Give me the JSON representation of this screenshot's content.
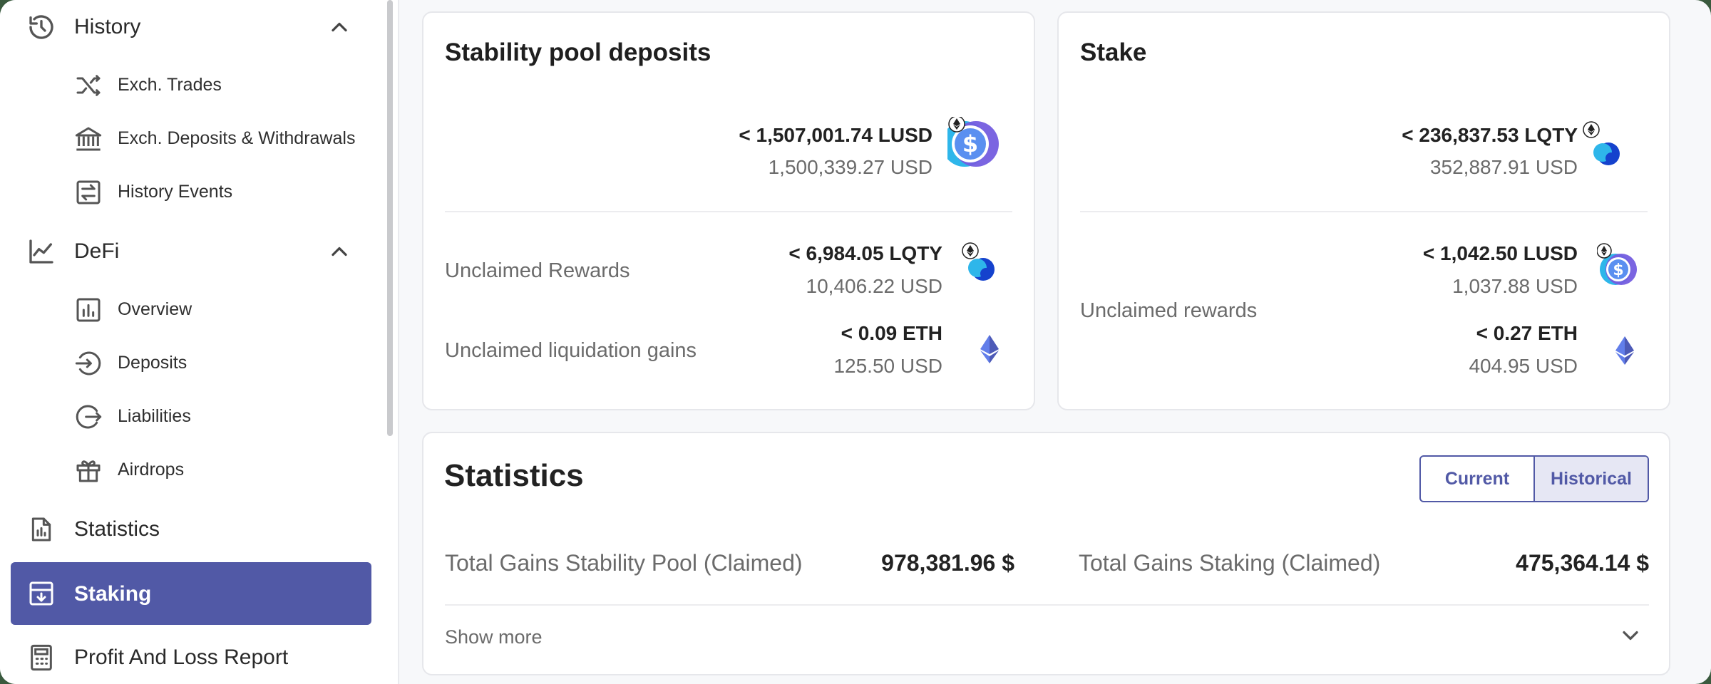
{
  "sidebar": {
    "history": {
      "label": "History",
      "icon": "history-icon",
      "chevron": "chevron-up-icon"
    },
    "history_items": [
      {
        "label": "Exch. Trades",
        "icon": "shuffle-icon"
      },
      {
        "label": "Exch. Deposits & Withdrawals",
        "icon": "bank-icon"
      },
      {
        "label": "History Events",
        "icon": "transfer-icon"
      }
    ],
    "defi": {
      "label": "DeFi",
      "icon": "chart-line-icon",
      "chevron": "chevron-up-icon"
    },
    "defi_items": [
      {
        "label": "Overview",
        "icon": "bar-chart-icon"
      },
      {
        "label": "Deposits",
        "icon": "login-circle-icon"
      },
      {
        "label": "Liabilities",
        "icon": "logout-circle-icon"
      },
      {
        "label": "Airdrops",
        "icon": "gift-icon"
      }
    ],
    "statistics": {
      "label": "Statistics",
      "icon": "file-chart-icon"
    },
    "staking": {
      "label": "Staking",
      "icon": "archive-icon"
    },
    "pnl": {
      "label": "Profit And Loss Report",
      "icon": "calculator-icon"
    },
    "active_color": "#5159a6"
  },
  "stability_pool": {
    "title": "Stability pool deposits",
    "deposit": {
      "amount": "< 1,507,001.74 LUSD",
      "usd": "1,500,339.27 USD",
      "token": "lusd-icon"
    },
    "unclaimed_rewards": {
      "label": "Unclaimed Rewards",
      "amount": "< 6,984.05 LQTY",
      "usd": "10,406.22 USD",
      "token": "lqty-icon"
    },
    "liquidation_gains": {
      "label": "Unclaimed liquidation gains",
      "amount": "< 0.09 ETH",
      "usd": "125.50 USD",
      "token": "eth-icon"
    }
  },
  "stake": {
    "title": "Stake",
    "staked": {
      "amount": "< 236,837.53 LQTY",
      "usd": "352,887.91 USD",
      "token": "lqty-icon"
    },
    "unclaimed_label": "Unclaimed rewards",
    "reward_lusd": {
      "amount": "< 1,042.50 LUSD",
      "usd": "1,037.88 USD",
      "token": "lusd-icon"
    },
    "reward_eth": {
      "amount": "< 0.27 ETH",
      "usd": "404.95 USD",
      "token": "eth-icon"
    }
  },
  "statistics": {
    "title": "Statistics",
    "toggle": {
      "current": "Current",
      "historical": "Historical",
      "selected": "Historical"
    },
    "stability_label": "Total Gains Stability Pool (Claimed)",
    "stability_value": "978,381.96 $",
    "staking_label": "Total Gains Staking (Claimed)",
    "staking_value": "475,364.14 $",
    "show_more": "Show more"
  },
  "colors": {
    "accent": "#5159a6",
    "lusd_blue": "#2eb6ea",
    "lusd_purple": "#745ddf",
    "lqty_blue": "#1542cd",
    "eth": "#627eea"
  }
}
